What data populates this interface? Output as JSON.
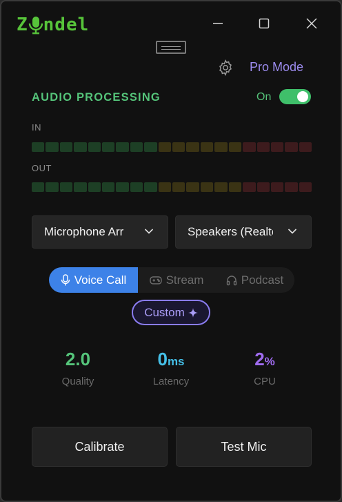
{
  "app": {
    "name_pre": "Z",
    "name_post": "ndel"
  },
  "header": {
    "pro_mode_label": "Pro Mode"
  },
  "processing": {
    "title": "AUDIO PROCESSING",
    "state_label": "On",
    "enabled": true
  },
  "meters": {
    "in_label": "IN",
    "out_label": "OUT",
    "segment_count": 20,
    "level_in": 0,
    "level_out": 0,
    "colors": {
      "green": "#1d3f25",
      "yellow": "#3a3314",
      "red": "#3d1b1d"
    }
  },
  "devices": {
    "input": "Microphone Arr",
    "output": "Speakers (Realte"
  },
  "modes": {
    "items": [
      {
        "label": "Voice Call",
        "icon": "mic-icon",
        "active": true
      },
      {
        "label": "Stream",
        "icon": "gamepad-icon",
        "active": false
      },
      {
        "label": "Podcast",
        "icon": "headphones-icon",
        "active": false
      }
    ],
    "custom_label": "Custom",
    "custom_icon": "sparkle-icon"
  },
  "stats": {
    "quality": {
      "value": "2.0",
      "unit": "",
      "label": "Quality",
      "color": "#55c47a"
    },
    "latency": {
      "value": "0",
      "unit": "ms",
      "label": "Latency",
      "color": "#45c0e8"
    },
    "cpu": {
      "value": "2",
      "unit": "%",
      "label": "CPU",
      "color": "#a06cf0"
    }
  },
  "actions": {
    "calibrate": "Calibrate",
    "test_mic": "Test Mic"
  },
  "colors": {
    "accent_green": "#55c47a",
    "accent_blue": "#3d82e8",
    "accent_purple": "#8a7cf0"
  }
}
